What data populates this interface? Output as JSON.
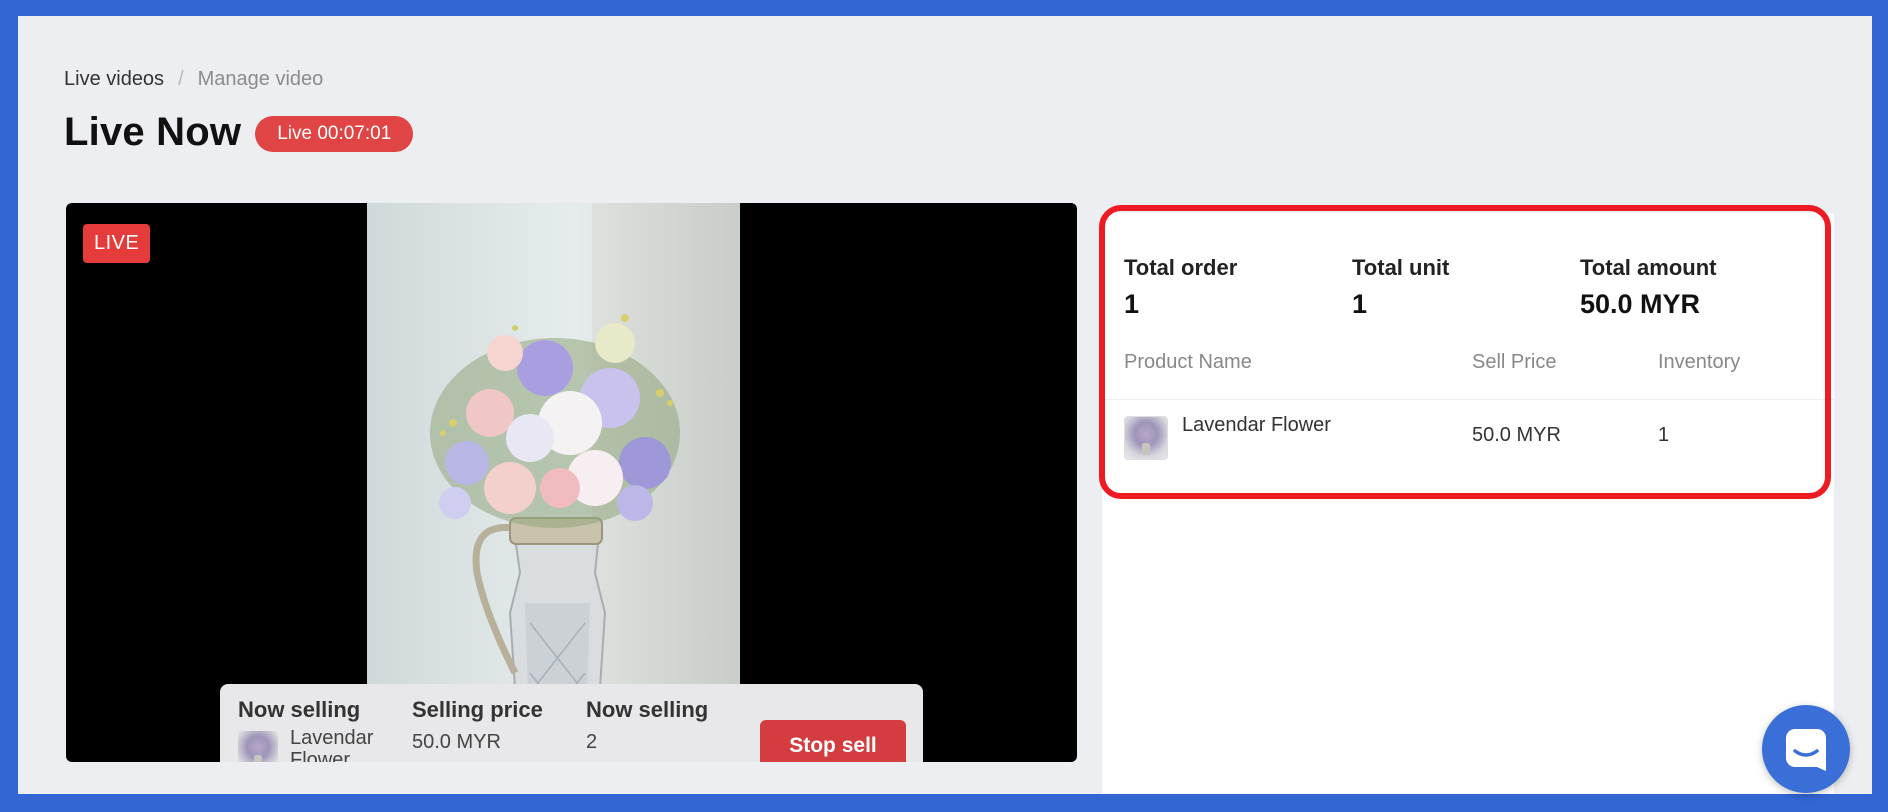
{
  "breadcrumb": {
    "parent": "Live videos",
    "separator": "/",
    "current": "Manage video"
  },
  "header": {
    "title": "Live Now",
    "live_timer": "Live 00:07:01"
  },
  "video": {
    "live_badge": "LIVE"
  },
  "selling_bar": {
    "now_selling_label": "Now selling",
    "product_name": "Lavendar Flower",
    "selling_price_label": "Selling price",
    "selling_price": "50.0 MYR",
    "now_selling_count_label": "Now selling",
    "now_selling_count": "2",
    "stop_sell_label": "Stop sell"
  },
  "stats": {
    "total_order_label": "Total order",
    "total_order": "1",
    "total_unit_label": "Total unit",
    "total_unit": "1",
    "total_amount_label": "Total amount",
    "total_amount": "50.0 MYR"
  },
  "orders_table": {
    "columns": [
      "Product Name",
      "Sell Price",
      "Inventory"
    ],
    "rows": [
      {
        "product": "Lavendar Flower",
        "price": "50.0 MYR",
        "inventory": "1"
      }
    ]
  },
  "colors": {
    "frame_border": "#3266d3",
    "live_red": "#e14444",
    "stop_sell_red": "#d33d3f",
    "highlight_red": "#ee1b22",
    "chat_blue": "#3a6fd8"
  },
  "icons": {
    "chat": "chat-bubble-icon"
  }
}
